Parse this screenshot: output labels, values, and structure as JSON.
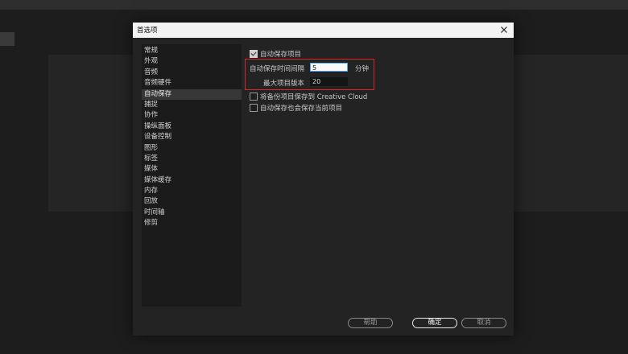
{
  "dialog": {
    "title": "首选项",
    "close_glyph": "×"
  },
  "sidebar": {
    "items": [
      {
        "label": "常规"
      },
      {
        "label": "外观"
      },
      {
        "label": "音频"
      },
      {
        "label": "音频硬件"
      },
      {
        "label": "自动保存",
        "selected": true
      },
      {
        "label": "捕捉"
      },
      {
        "label": "协作"
      },
      {
        "label": "操纵面板"
      },
      {
        "label": "设备控制"
      },
      {
        "label": "图形"
      },
      {
        "label": "标签"
      },
      {
        "label": "媒体"
      },
      {
        "label": "媒体缓存"
      },
      {
        "label": "内存"
      },
      {
        "label": "回放"
      },
      {
        "label": "时间轴"
      },
      {
        "label": "修剪"
      }
    ]
  },
  "autosave": {
    "enable_label": "自动保存项目",
    "enable_checked": true,
    "interval_label": "自动保存时间间隔",
    "interval_value": "5",
    "interval_unit": "分钟",
    "max_label": "最大项目版本",
    "max_value": "20",
    "cloud_label": "将备份项目保存到 Creative Cloud",
    "cloud_checked": false,
    "current_label": "自动保存也会保存当前项目",
    "current_checked": false
  },
  "buttons": {
    "help": "帮助",
    "ok": "确定",
    "cancel": "取消"
  },
  "colors": {
    "highlight": "#d9262b",
    "focus": "#58a5ff"
  }
}
